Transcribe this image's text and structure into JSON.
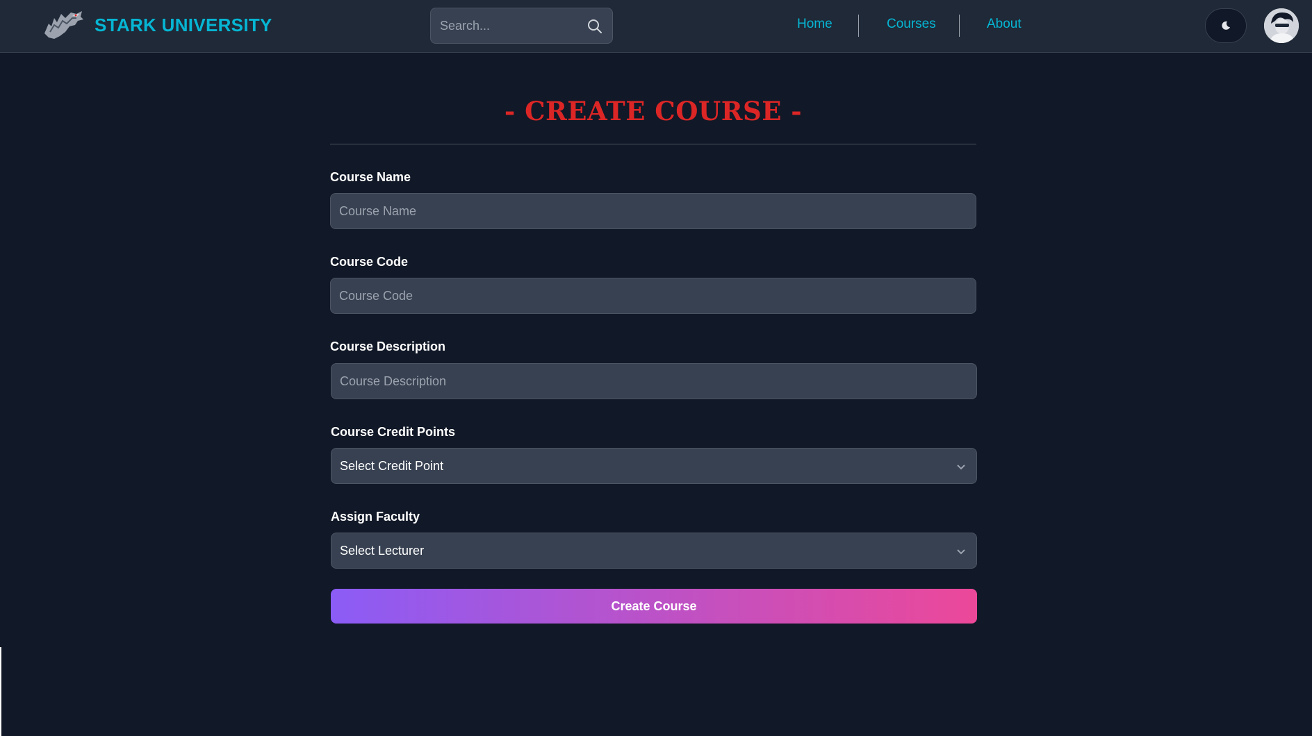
{
  "header": {
    "brand": "STARK UNIVERSITY",
    "search_placeholder": "Search...",
    "nav": [
      "Home",
      "Courses",
      "About"
    ]
  },
  "form": {
    "title": "- CREATE COURSE -",
    "course_name": {
      "label": "Course Name",
      "placeholder": "Course Name"
    },
    "course_code": {
      "label": "Course Code",
      "placeholder": "Course Code"
    },
    "course_description": {
      "label": "Course Description",
      "placeholder": "Course Description"
    },
    "credit_points": {
      "label": "Course Credit Points",
      "selected": "Select Credit Point"
    },
    "faculty": {
      "label": "Assign Faculty",
      "selected": "Select Lecturer"
    },
    "submit_label": "Create Course"
  },
  "colors": {
    "background": "#111827",
    "navbar": "#1f2937",
    "brand": "#06b6d4",
    "title": "#dc2626",
    "button_gradient_start": "#8b5cf6",
    "button_gradient_end": "#ec4899"
  },
  "icons": [
    "direwolf-logo",
    "search-icon",
    "moon-icon",
    "avatar",
    "chevron-down-icon"
  ]
}
